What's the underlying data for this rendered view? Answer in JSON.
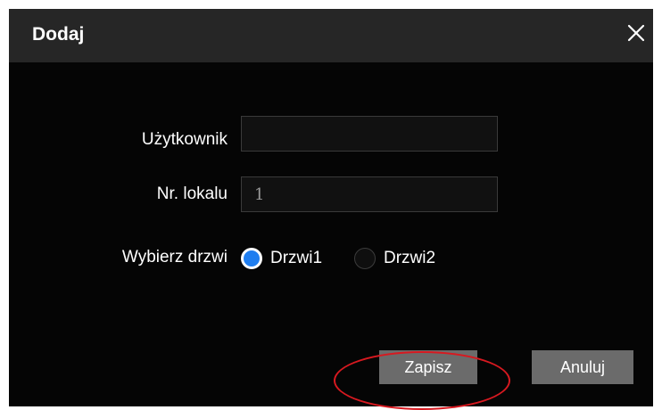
{
  "dialog": {
    "title": "Dodaj",
    "close_icon": "close-icon"
  },
  "form": {
    "user_label": "Użytkownik",
    "user_value": "",
    "room_label": "Nr. lokalu",
    "room_value": "1",
    "door_label": "Wybierz drzwi",
    "doors": [
      {
        "label": "Drzwi1",
        "checked": true
      },
      {
        "label": "Drzwi2",
        "checked": false
      }
    ]
  },
  "buttons": {
    "save_label": "Zapisz",
    "cancel_label": "Anuluj"
  },
  "colors": {
    "accent": "#1f7ef0",
    "highlight_ring": "#d71920",
    "button": "#6b6b6b"
  }
}
